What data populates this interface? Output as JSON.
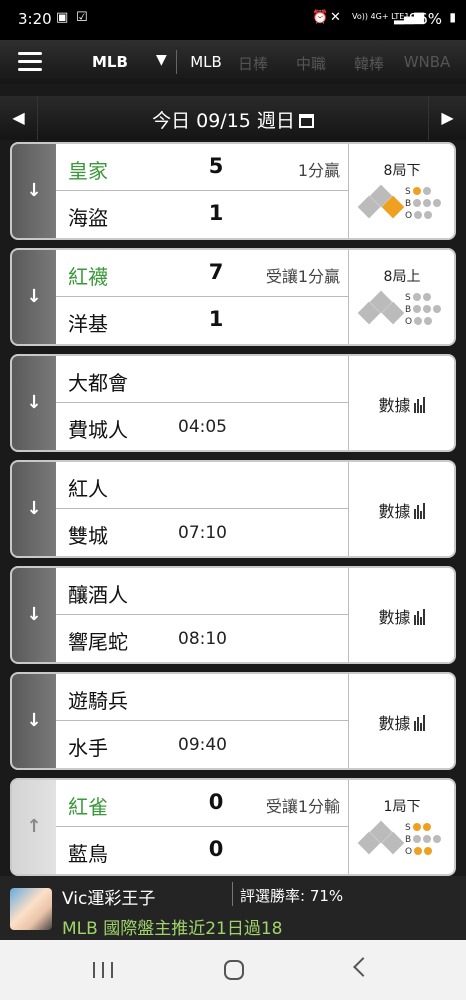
{
  "status": {
    "time": "3:20",
    "battery": "86%",
    "signal_text": "Vo)) 4G+ LTE1"
  },
  "nav": {
    "league_selected": "MLB",
    "tabs": [
      {
        "label": "MLB",
        "active": true
      },
      {
        "label": "日棒",
        "active": false
      },
      {
        "label": "中職",
        "active": false
      },
      {
        "label": "韓棒",
        "active": false
      },
      {
        "label": "WNBA",
        "active": false
      }
    ]
  },
  "date_bar": {
    "label": "今日 09/15 週日",
    "prev": "◀",
    "next": "▶"
  },
  "games": [
    {
      "away": "皇家",
      "away_score": "5",
      "home": "海盜",
      "home_score": "1",
      "note": "1分贏",
      "inning": "8局下",
      "bases": [
        "off",
        "off",
        "on"
      ],
      "balls": 0,
      "strikes": 1,
      "outs": 0,
      "expander": "down"
    },
    {
      "away": "紅襪",
      "away_score": "7",
      "home": "洋基",
      "home_score": "1",
      "note": "受讓1分贏",
      "inning": "8局上",
      "bases": [
        "off",
        "off",
        "off"
      ],
      "balls": 0,
      "strikes": 0,
      "outs": 0,
      "expander": "down"
    },
    {
      "away": "大都會",
      "home": "費城人",
      "time": "04:05",
      "stats_label": "數據",
      "expander": "down"
    },
    {
      "away": "紅人",
      "home": "雙城",
      "time": "07:10",
      "stats_label": "數據",
      "expander": "down"
    },
    {
      "away": "釀酒人",
      "home": "響尾蛇",
      "time": "08:10",
      "stats_label": "數據",
      "expander": "down"
    },
    {
      "away": "遊騎兵",
      "home": "水手",
      "time": "09:40",
      "stats_label": "數據",
      "expander": "down"
    },
    {
      "away": "紅雀",
      "away_score": "0",
      "home": "藍鳥",
      "home_score": "0",
      "note": "受讓1分輸",
      "inning": "1局下",
      "bases": [
        "off",
        "off",
        "off"
      ],
      "balls": 0,
      "strikes": 2,
      "outs": 2,
      "expander": "up"
    }
  ],
  "promo": {
    "name": "Vic運彩王子",
    "rate": "評選勝率: 71%",
    "message": "MLB 國際盤主推近21日過18"
  },
  "colors": {
    "accent_green": "#3a9a3a",
    "base_on": "#f0a020",
    "promo_green": "#9fd46a"
  }
}
